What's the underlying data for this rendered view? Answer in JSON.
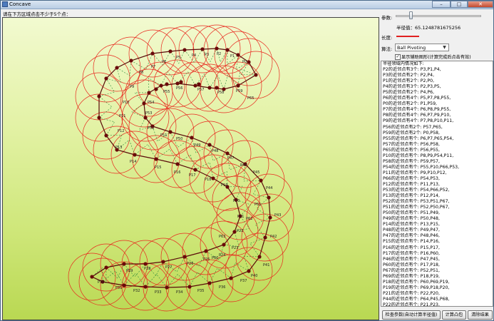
{
  "window": {
    "title": "Concave",
    "min_symbol": "–",
    "max_symbol": "□",
    "close_symbol": "✕"
  },
  "prompt": "请在下方区域点击不少于5个点：",
  "params": {
    "label": "参数:",
    "radius_text": "半径值：65.1248781675256",
    "length_label": "长度:",
    "algo_label": "算法:",
    "algo_value": "Ball Pivoting",
    "checkbox_label": "显示辅助图形(计算完成后点击有效)",
    "checkbox_checked": true,
    "line_color": "#e02020"
  },
  "neighbors": {
    "header": "半径领域内情况如下:",
    "lines": [
      "P2的近邻点有3个: P3,P1,P4,",
      "P3的近邻点有2个: P2,P4,",
      "P1的近邻点有2个: P2,P0,",
      "P4的近邻点有3个: P2,P3,P5,",
      "P5的近邻点有2个: P4,P6,",
      "P6的近邻点有4个: P5,P7,P8,P55,",
      "P0的近邻点有2个: P1,P59,",
      "P7的近邻点有4个: P6,P8,P9,P55,",
      "P8的近邻点有4个: P6,P7,P9,P10,",
      "P9的近邻点有4个: P7,P8,P10,P11,",
      "P56的近邻点有2个: P57,P65,",
      "P59的近邻点有2个: P0,P58,",
      "P55的近邻点有个: P6,P7,P65,P54,",
      "P57的近邻点有个: P56,P58,",
      "P65的近邻点有个: P56,P55,",
      "P10的近邻点有个: P8,P9,P54,P11,",
      "P58的近邻点有个: P59,P57,",
      "P54的近邻点有个: P55,P10,P66,P53,",
      "P11的近邻点有个: P9,P10,P12,",
      "P66的近邻点有个: P54,P53,",
      "P12的近邻点有个: P11,P13,",
      "P53的近邻点有个: P54,P66,P52,",
      "P13的近邻点有个: P12,P14,",
      "P52的近邻点有个: P53,P51,P67,",
      "P51的近邻点有个: P52,P50,P67,",
      "P50的近邻点有个: P51,P49,",
      "P49的近邻点有个: P50,P48,",
      "P14的近邻点有个: P13,P15,",
      "P48的近邻点有个: P49,P47,",
      "P47的近邻点有个: P48,P46,",
      "P15的近邻点有个: P14,P16,",
      "P16的近邻点有个: P15,P17,",
      "P17的近邻点有个: P16,P60,",
      "P46的近邻点有个: P47,P45,",
      "P60的近邻点有个: P17,P18,",
      "P67的近邻点有个: P52,P51,",
      "P69的近邻点有个: P18,P19,",
      "P18的近邻点有个: P60,P69,P19,",
      "P19的近邻点有个: P69,P18,P20,",
      "P21的近邻点有个: P22,P20,",
      "P44的近邻点有个: P64,P45,P68,",
      "P22的近邻点有个: P21,P23,"
    ]
  },
  "buttons": {
    "check_params": "检查参数(自动计算半径值)",
    "compute_hull": "计算凸包",
    "clear": "清除结果"
  },
  "canvas": {
    "point_labels": [
      "P0",
      "P1",
      "P2",
      "P3",
      "P4",
      "P5",
      "P6",
      "P7",
      "P8",
      "P9",
      "P10",
      "P11",
      "P12",
      "P13",
      "P14",
      "P15",
      "P16",
      "P17",
      "P18",
      "P19",
      "P20",
      "P21",
      "P22",
      "P23",
      "P24",
      "P25",
      "P26",
      "P27",
      "P28",
      "P29",
      "P30",
      "P31",
      "P32",
      "P33",
      "P34",
      "P35",
      "P36",
      "P37",
      "P38",
      "P39",
      "P40",
      "P41",
      "P42",
      "P43",
      "P44",
      "P45",
      "P46",
      "P47",
      "P48",
      "P49",
      "P50",
      "P51",
      "P52",
      "P53",
      "P54",
      "P55",
      "P56",
      "P57",
      "P58",
      "P59",
      "P60",
      "P61",
      "P62",
      "P63",
      "P64",
      "P65",
      "P66"
    ],
    "circle_color": "#e8281e",
    "hull_color": "#5a0a0a",
    "point_color": "#6a0a0a",
    "aux_color": "#2a8a3a"
  }
}
